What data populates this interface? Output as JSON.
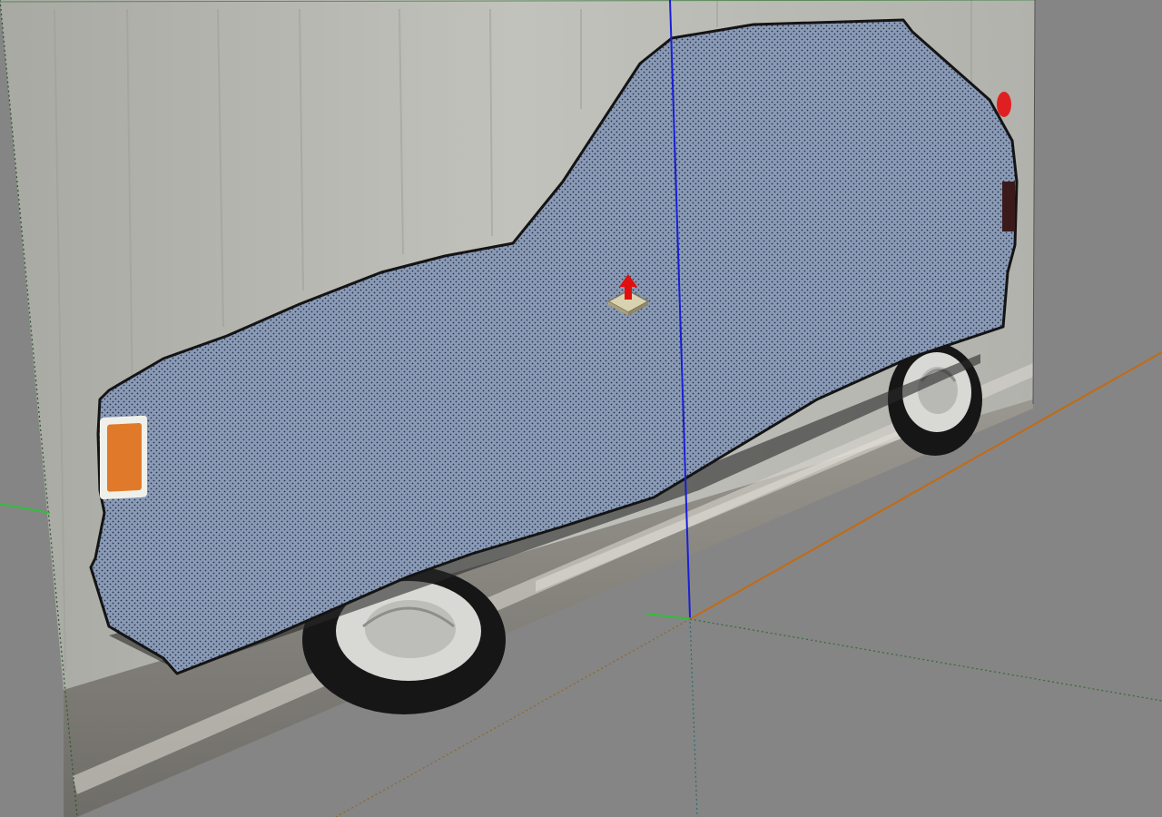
{
  "viewport": {
    "background_color": "#858585",
    "wall_color": "#b7b7b1",
    "floor_color": "#8a8882",
    "selected_face_color": "#8a9bb8",
    "selected_face_stipple_color": "#2b3140",
    "outline_color": "#141414",
    "blue_axis_color": "#1a1fd6",
    "red_axis_color": "#c46a12",
    "green_axis_color": "#2fbf3a",
    "gizmo_arrow_color": "#e01010",
    "gizmo_base_color": "#d9d2b0"
  },
  "icons": {
    "push_pull_cursor": "push-pull-icon",
    "taillight": "taillight-icon",
    "wheel": "wheel-icon"
  }
}
